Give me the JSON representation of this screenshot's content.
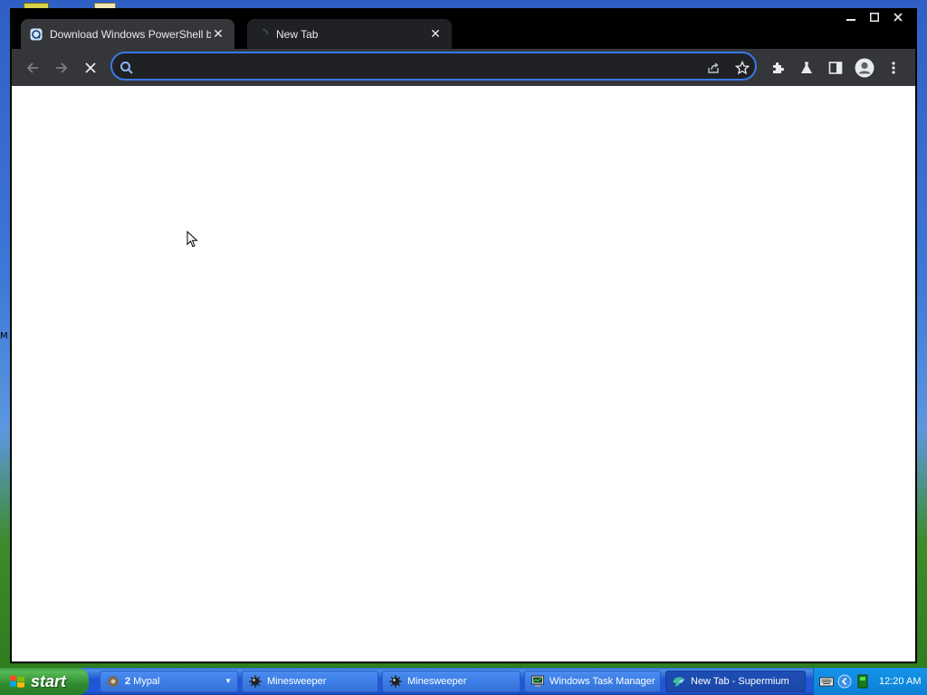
{
  "browser": {
    "tabs": [
      {
        "title": "Download Windows PowerShell by M",
        "active": true,
        "favicon": "site-icon"
      },
      {
        "title": "New Tab",
        "active": false,
        "favicon": "loading-icon"
      }
    ],
    "omnibox": {
      "value": "",
      "placeholder": ""
    },
    "colors": {
      "frame": "#000000",
      "toolbar": "#35363a",
      "omnibox_border": "#3b78e7",
      "page": "#ffffff"
    }
  },
  "taskbar": {
    "start_label": "start",
    "tasks": [
      {
        "label": "Mypal",
        "count": "2",
        "icon": "mypal-icon"
      },
      {
        "label": "Minesweeper",
        "icon": "minesweeper-icon"
      },
      {
        "label": "Minesweeper",
        "icon": "minesweeper-icon"
      },
      {
        "label": "Windows Task Manager",
        "icon": "task-manager-icon"
      },
      {
        "label": "New Tab - Supermium",
        "icon": "supermium-icon",
        "active": true
      }
    ],
    "clock": "12:20 AM"
  },
  "desktop": {
    "edge_text": "M"
  }
}
